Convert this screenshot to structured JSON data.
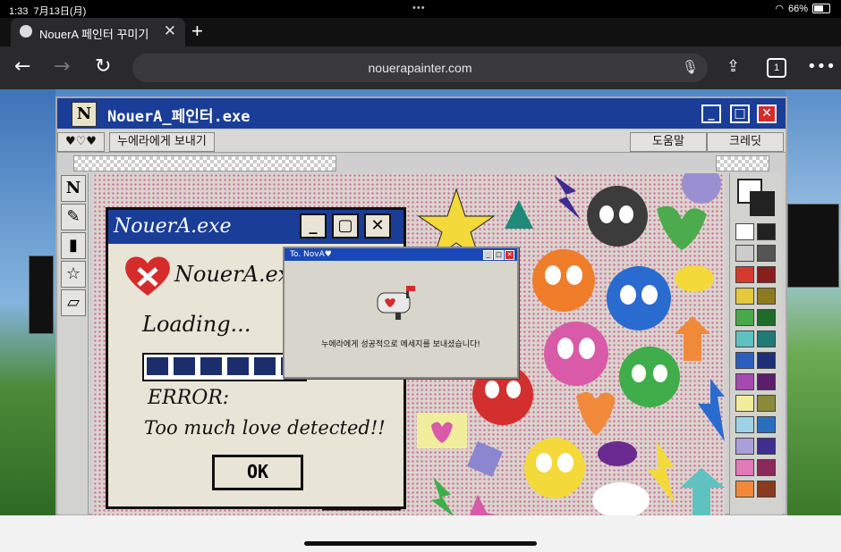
{
  "status": {
    "time": "1:33",
    "date": "7月13日(月)",
    "battery": "66%"
  },
  "browser": {
    "tab_title": "NouerA 페인터 꾸미기",
    "url": "nouerapainter.com",
    "tab_count": "1"
  },
  "app": {
    "title": "NouerA_페인터.exe",
    "menu": {
      "hearts": "♥♡♥",
      "send": "누에라에게 보내기",
      "help": "도움말",
      "credits": "크레딧"
    }
  },
  "error_dialog": {
    "title": "NouerA.exe",
    "app_name": "NouerA.exe",
    "loading": "Loading...",
    "error_label": "ERROR:",
    "error_message": "Too much love detected!!",
    "ok": "OK",
    "progress": 0.8
  },
  "message_dialog": {
    "title": "To. NovA♥",
    "text": "누에라에게 성공적으로 메세지를 보내셨습니다!"
  },
  "colors": {
    "titlebar": "#1a3d97",
    "accent_red": "#d52b2b",
    "progress_block": "#1b2e6b"
  },
  "palette": [
    "#ffffff",
    "#222222",
    "#cccccc",
    "#555555",
    "#d63a2f",
    "#8a1e1e",
    "#e3c93b",
    "#8c7b1e",
    "#49a84a",
    "#1f6b2b",
    "#5fc2c0",
    "#1f7a78",
    "#2b5fbf",
    "#1e2f7a",
    "#a44bb0",
    "#5a1e6b",
    "#f0ee9c",
    "#8a8a3a",
    "#9ed2e6",
    "#2a6fbf",
    "#a9a0d9",
    "#3e2f8f",
    "#e07ab8",
    "#8a2a5a",
    "#f08a3a",
    "#8a3a1e"
  ],
  "icons": [
    "search-icon",
    "mic-icon",
    "share-icon",
    "more-icon"
  ]
}
